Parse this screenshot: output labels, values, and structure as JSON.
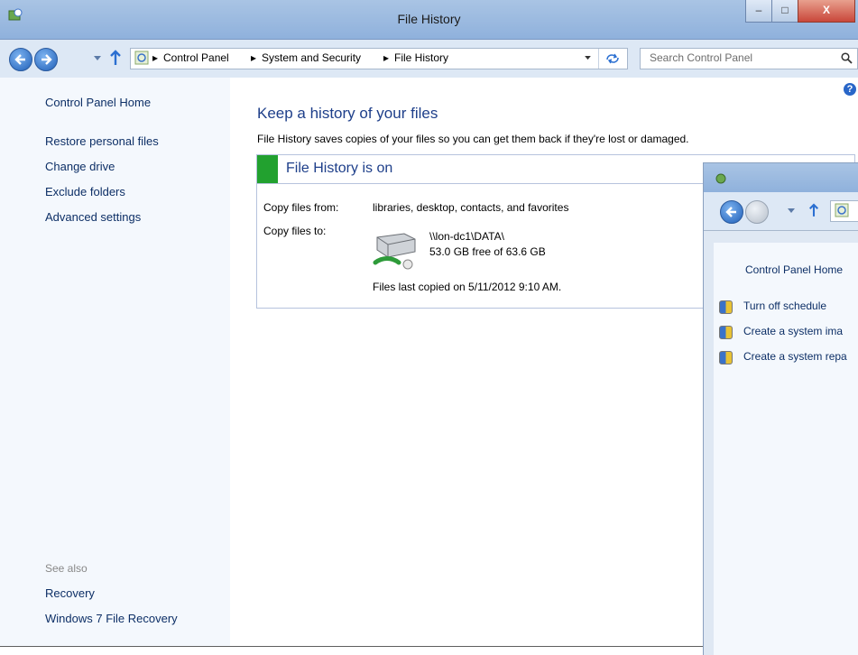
{
  "window": {
    "title": "File History",
    "minimize_label": "–",
    "maximize_label": "□",
    "close_label": "X"
  },
  "navbar": {
    "breadcrumbs": [
      "Control Panel",
      "System and Security",
      "File History"
    ],
    "search_placeholder": "Search Control Panel"
  },
  "sidebar": {
    "home": "Control Panel Home",
    "links": [
      "Restore personal files",
      "Change drive",
      "Exclude folders",
      "Advanced settings"
    ],
    "see_also_label": "See also",
    "see_also_links": [
      "Recovery",
      "Windows 7 File Recovery"
    ]
  },
  "main": {
    "heading": "Keep a history of your files",
    "description": "File History saves copies of your files so you can get them back if they're lost or damaged.",
    "status_title": "File History is on",
    "copy_from_label": "Copy files from:",
    "copy_from_value": "libraries, desktop, contacts, and favorites",
    "copy_to_label": "Copy files to:",
    "drive_path": "\\\\lon-dc1\\DATA\\",
    "drive_space": "53.0 GB free of 63.6 GB",
    "last_copied": "Files last copied on 5/11/2012 9:10 AM.",
    "status_color": "#22a12f"
  },
  "second_window": {
    "home": "Control Panel Home",
    "links": [
      "Turn off schedule",
      "Create a system ima",
      "Create a system repa"
    ]
  }
}
